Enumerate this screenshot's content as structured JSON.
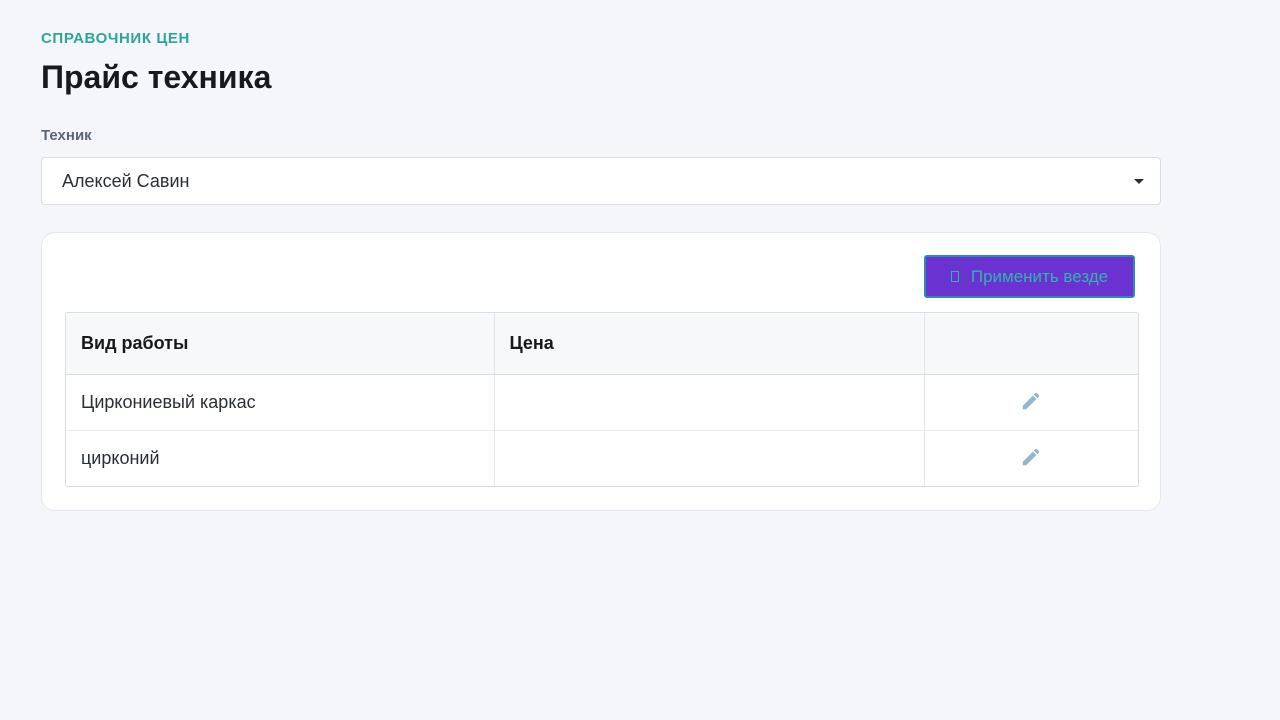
{
  "header": {
    "eyebrow": "СПРАВОЧНИК ЦЕН",
    "title": "Прайс техника"
  },
  "technician_field": {
    "label": "Техник",
    "selected": "Алексей Савин"
  },
  "toolbar": {
    "apply_label": "Применить везде"
  },
  "table": {
    "columns": [
      "Вид работы",
      "Цена",
      ""
    ],
    "rows": [
      {
        "work": "Циркониевый каркас",
        "price": ""
      },
      {
        "work": "цирконий",
        "price": ""
      }
    ]
  },
  "icons": {
    "edit": "pencil-icon",
    "dropdown": "caret-down-icon"
  },
  "colors": {
    "accent": "#2fa59a",
    "button": "#6a33d1",
    "icon": "#8fb8d0"
  }
}
